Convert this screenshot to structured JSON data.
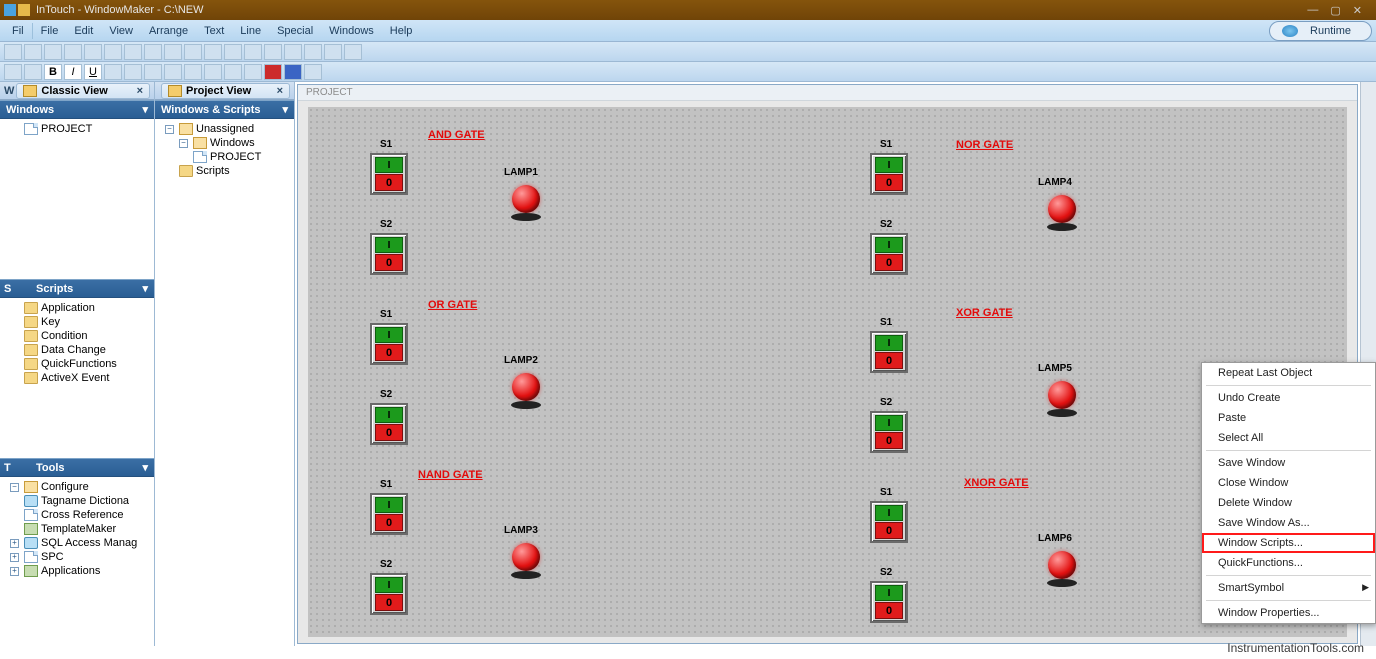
{
  "titlebar": {
    "app_title": "InTouch - WindowMaker - C:\\NEW"
  },
  "win_controls": {
    "min": "—",
    "max": "▢",
    "close": "✕"
  },
  "menus": [
    "Fil",
    "File",
    "Edit",
    "View",
    "Arrange",
    "Text",
    "Line",
    "Special",
    "Windows",
    "Help"
  ],
  "runtime_label": "Runtime",
  "panelA": {
    "tab": "Classic View"
  },
  "panelB": {
    "tab": "Project View"
  },
  "windows_header": "Windows",
  "windows_items": [
    "PROJECT"
  ],
  "scripts_header": "Scripts",
  "scripts_items": [
    "Application",
    "Key",
    "Condition",
    "Data Change",
    "QuickFunctions",
    "ActiveX Event"
  ],
  "tools_header": "Tools",
  "tools_items": [
    "Configure",
    "Tagname Dictiona",
    "Cross Reference",
    "TemplateMaker",
    "SQL Access Manag",
    "SPC",
    "Applications"
  ],
  "proj_header": "Windows & Scripts",
  "proj_tree": {
    "root": "Unassigned",
    "windows": "Windows",
    "project": "PROJECT",
    "scripts": "Scripts"
  },
  "canvas_title": "PROJECT",
  "gates": {
    "and": "AND GATE",
    "or": "OR GATE",
    "nand": "NAND GATE",
    "nor": "NOR GATE",
    "xor": "XOR GATE",
    "xnor": "XNOR GATE"
  },
  "labels": {
    "s1": "S1",
    "s2": "S2",
    "lamp1": "LAMP1",
    "lamp2": "LAMP2",
    "lamp3": "LAMP3",
    "lamp4": "LAMP4",
    "lamp5": "LAMP5",
    "lamp6": "LAMP6"
  },
  "switch": {
    "on": "I",
    "off": "0"
  },
  "context_menu": {
    "repeat": "Repeat Last Object",
    "undo": "Undo Create",
    "paste": "Paste",
    "select_all": "Select All",
    "save": "Save Window",
    "close": "Close Window",
    "delete": "Delete Window",
    "save_as": "Save Window As...",
    "win_scripts": "Window Scripts...",
    "quickfn": "QuickFunctions...",
    "smartsymbol": "SmartSymbol",
    "props": "Window Properties..."
  },
  "watermark": "InstrumentationTools.com"
}
